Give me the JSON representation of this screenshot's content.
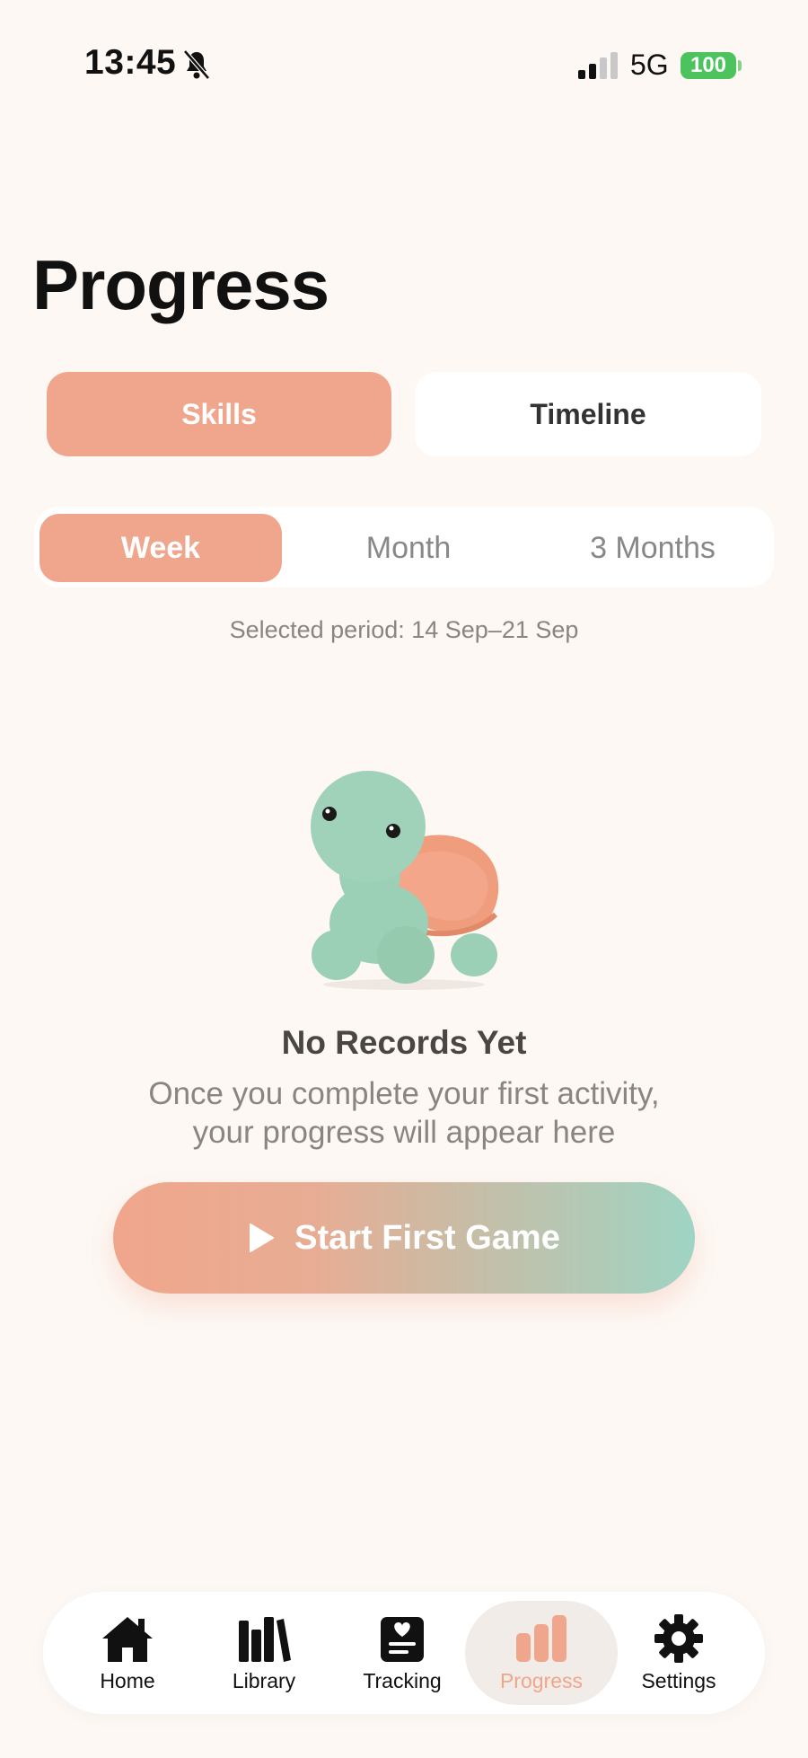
{
  "status_bar": {
    "time": "13:45",
    "network": "5G",
    "battery": "100",
    "icons": [
      "bell-off-icon",
      "signal-icon",
      "battery-icon"
    ]
  },
  "page": {
    "title": "Progress"
  },
  "view_segment": {
    "options": [
      "Skills",
      "Timeline"
    ],
    "selected": "Skills"
  },
  "period_segment": {
    "options": [
      "Week",
      "Month",
      "3 Months"
    ],
    "selected": "Week"
  },
  "selected_period_text": "Selected period: 14 Sep–21 Sep",
  "empty_state": {
    "illustration": "turtle-mascot",
    "title": "No Records Yet",
    "line1": "Once you complete your first activity,",
    "line2": "your progress will appear here"
  },
  "cta": {
    "label": "Start First Game",
    "icon": "play-icon"
  },
  "tabbar": {
    "items": [
      {
        "label": "Home",
        "icon": "home-icon"
      },
      {
        "label": "Library",
        "icon": "library-icon"
      },
      {
        "label": "Tracking",
        "icon": "tracking-icon"
      },
      {
        "label": "Progress",
        "icon": "bar-chart-icon"
      },
      {
        "label": "Settings",
        "icon": "gear-icon"
      }
    ],
    "active": "Progress"
  },
  "colors": {
    "accent": "#f0a68c",
    "mint": "#9fd4c3",
    "background": "#fdf8f4",
    "battery": "#4cc35c"
  }
}
